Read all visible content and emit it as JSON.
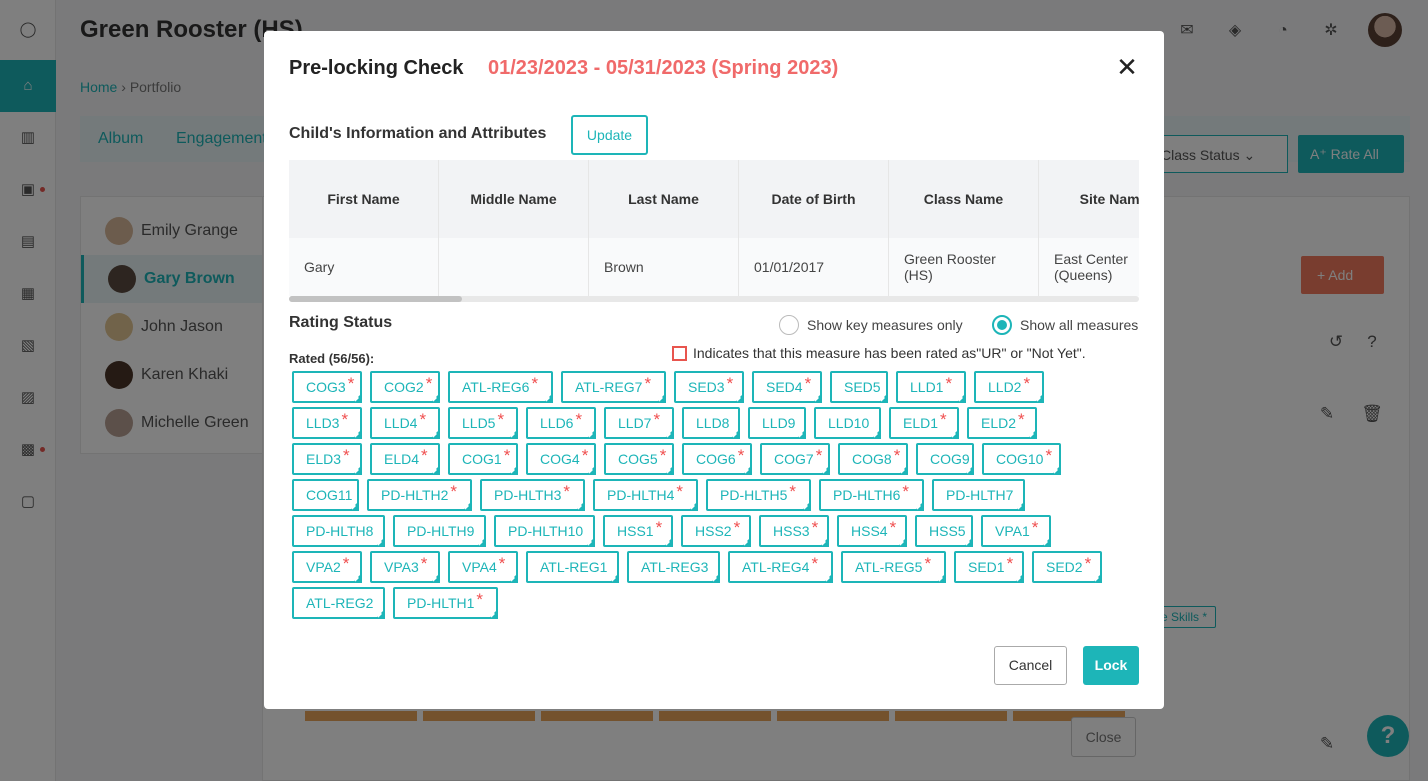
{
  "app": {
    "title": "Green Rooster (HS)",
    "breadcrumb": {
      "home": "Home",
      "current": "Portfolio"
    },
    "tabs": [
      "Album",
      "Engagement"
    ],
    "students": [
      {
        "name": "Emily Grange"
      },
      {
        "name": "Gary Brown",
        "selected": true
      },
      {
        "name": "John Jason"
      },
      {
        "name": "Karen Khaki"
      },
      {
        "name": "Michelle Green"
      }
    ],
    "status_select": "Class Status",
    "rate_all": "Rate All",
    "add": "Add",
    "skills_tag": "e Skills *",
    "close": "Close",
    "help": "?"
  },
  "modal": {
    "title": "Pre-locking Check",
    "date_range": "01/23/2023 - 05/31/2023 (Spring 2023)",
    "child_section_title": "Child's Information and Attributes",
    "update_label": "Update",
    "table": {
      "headers": [
        "First Name",
        "Middle Name",
        "Last Name",
        "Date of Birth",
        "Class Name",
        "Site Name"
      ],
      "row": [
        "Gary",
        "",
        "Brown",
        "01/01/2017",
        "Green Rooster (HS)",
        "East Center (Queens)"
      ]
    },
    "rating_status_title": "Rating Status",
    "radio_key": "Show key measures only",
    "radio_all": "Show all measures",
    "selected_view": "all",
    "rated_label": "Rated (56/56):",
    "legend_text": "Indicates that this measure has been rated as\"UR\" or \"Not Yet\".",
    "measures": [
      [
        {
          "l": "COG3",
          "a": true
        },
        {
          "l": "COG2",
          "a": true
        },
        {
          "l": "ATL-REG6",
          "a": true
        },
        {
          "l": "ATL-REG7",
          "a": true
        },
        {
          "l": "SED3",
          "a": true
        },
        {
          "l": "SED4",
          "a": true
        },
        {
          "l": "SED5",
          "a": false
        },
        {
          "l": "LLD1",
          "a": true
        },
        {
          "l": "LLD2",
          "a": true
        }
      ],
      [
        {
          "l": "LLD3",
          "a": true
        },
        {
          "l": "LLD4",
          "a": true
        },
        {
          "l": "LLD5",
          "a": true
        },
        {
          "l": "LLD6",
          "a": true
        },
        {
          "l": "LLD7",
          "a": true
        },
        {
          "l": "LLD8",
          "a": false
        },
        {
          "l": "LLD9",
          "a": false
        },
        {
          "l": "LLD10",
          "a": false
        },
        {
          "l": "ELD1",
          "a": true
        },
        {
          "l": "ELD2",
          "a": true
        }
      ],
      [
        {
          "l": "ELD3",
          "a": true
        },
        {
          "l": "ELD4",
          "a": true
        },
        {
          "l": "COG1",
          "a": true
        },
        {
          "l": "COG4",
          "a": true
        },
        {
          "l": "COG5",
          "a": true
        },
        {
          "l": "COG6",
          "a": true
        },
        {
          "l": "COG7",
          "a": true
        },
        {
          "l": "COG8",
          "a": true
        },
        {
          "l": "COG9",
          "a": false
        },
        {
          "l": "COG10",
          "a": true
        }
      ],
      [
        {
          "l": "COG11",
          "a": false
        },
        {
          "l": "PD-HLTH2",
          "a": true
        },
        {
          "l": "PD-HLTH3",
          "a": true
        },
        {
          "l": "PD-HLTH4",
          "a": true
        },
        {
          "l": "PD-HLTH5",
          "a": true
        },
        {
          "l": "PD-HLTH6",
          "a": true
        },
        {
          "l": "PD-HLTH7",
          "a": false
        }
      ],
      [
        {
          "l": "PD-HLTH8",
          "a": false
        },
        {
          "l": "PD-HLTH9",
          "a": false
        },
        {
          "l": "PD-HLTH10",
          "a": false
        },
        {
          "l": "HSS1",
          "a": true
        },
        {
          "l": "HSS2",
          "a": true
        },
        {
          "l": "HSS3",
          "a": true
        },
        {
          "l": "HSS4",
          "a": true
        },
        {
          "l": "HSS5",
          "a": false
        },
        {
          "l": "VPA1",
          "a": true
        }
      ],
      [
        {
          "l": "VPA2",
          "a": true
        },
        {
          "l": "VPA3",
          "a": true
        },
        {
          "l": "VPA4",
          "a": true
        },
        {
          "l": "ATL-REG1",
          "a": false
        },
        {
          "l": "ATL-REG3",
          "a": false
        },
        {
          "l": "ATL-REG4",
          "a": true
        },
        {
          "l": "ATL-REG5",
          "a": true
        },
        {
          "l": "SED1",
          "a": true
        },
        {
          "l": "SED2",
          "a": true
        }
      ],
      [
        {
          "l": "ATL-REG2",
          "a": false
        },
        {
          "l": "PD-HLTH1",
          "a": true
        }
      ]
    ],
    "cancel_label": "Cancel",
    "lock_label": "Lock"
  },
  "colors": {
    "accent": "#1db5b8",
    "range": "#f06a6a",
    "asterisk": "#f05050",
    "add": "#f27a5e"
  }
}
